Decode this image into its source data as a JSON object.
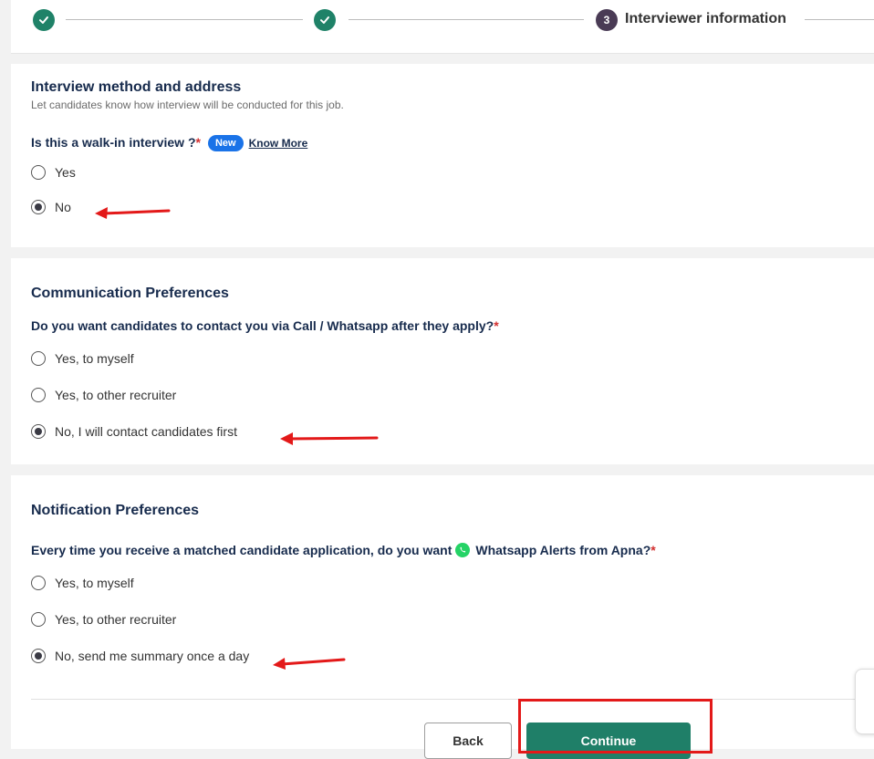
{
  "stepper": {
    "step3_number": "3",
    "step3_label": "Interviewer information"
  },
  "interview_section": {
    "title": "Interview method and address",
    "subtitle": "Let candidates know how interview will be conducted for this job.",
    "question": "Is this a walk-in interview ?",
    "required_mark": "*",
    "badge": "New",
    "know_more": "Know More",
    "options": [
      {
        "label": "Yes",
        "selected": false
      },
      {
        "label": "No",
        "selected": true
      }
    ]
  },
  "communication_section": {
    "title": "Communication Preferences",
    "question": "Do you want candidates to contact you via Call / Whatsapp after they apply?",
    "required_mark": "*",
    "options": [
      {
        "label": "Yes, to myself",
        "selected": false
      },
      {
        "label": "Yes, to other recruiter",
        "selected": false
      },
      {
        "label": "No, I will contact candidates first",
        "selected": true
      }
    ]
  },
  "notification_section": {
    "title": "Notification Preferences",
    "question_prefix": "Every time you receive a matched candidate application, do you want",
    "question_suffix": "Whatsapp Alerts from Apna?",
    "required_mark": "*",
    "options": [
      {
        "label": "Yes, to myself",
        "selected": false
      },
      {
        "label": "Yes, to other recruiter",
        "selected": false
      },
      {
        "label": "No, send me summary once a day",
        "selected": true
      }
    ]
  },
  "footer": {
    "back_label": "Back",
    "continue_label": "Continue"
  },
  "colors": {
    "brand_green": "#1f7f68",
    "badge_blue": "#1a73e8",
    "annotation_red": "#e31919",
    "step_active": "#4a3b55"
  }
}
